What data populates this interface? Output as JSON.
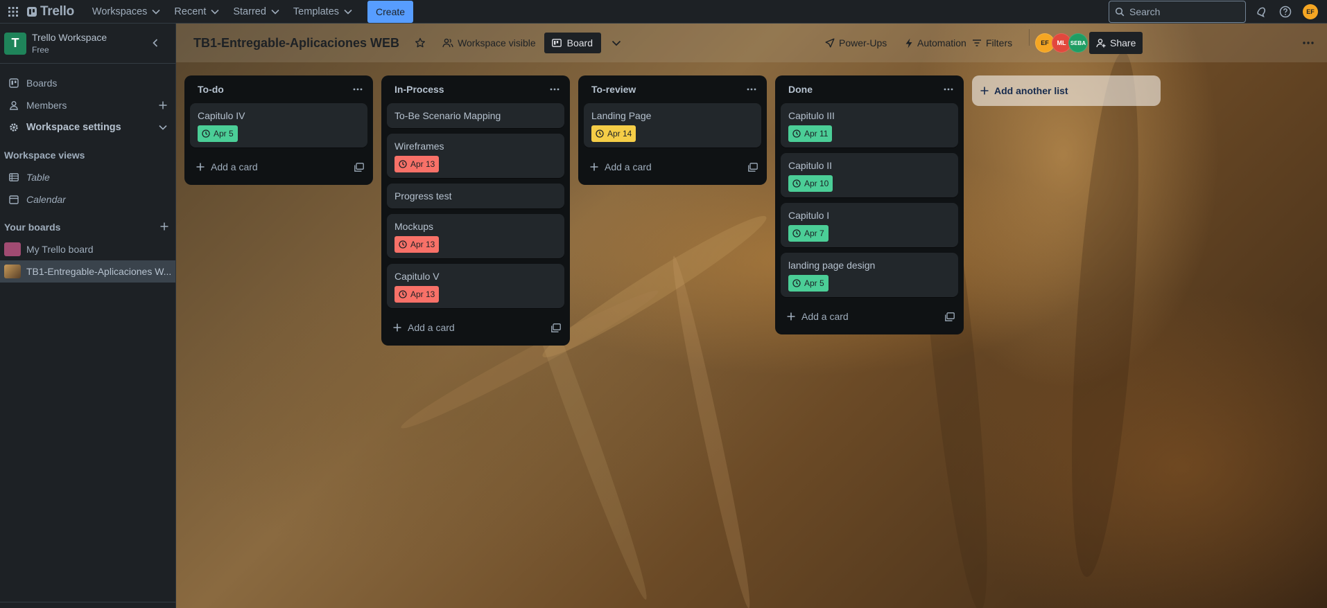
{
  "topnav": {
    "logo": "Trello",
    "menus": [
      "Workspaces",
      "Recent",
      "Starred",
      "Templates"
    ],
    "create_label": "Create",
    "search_placeholder": "Search",
    "user_initials": "EF"
  },
  "sidebar": {
    "workspace_initial": "T",
    "workspace_name": "Trello Workspace",
    "workspace_plan": "Free",
    "items": [
      {
        "label": "Boards",
        "icon": "boards-icon"
      },
      {
        "label": "Members",
        "icon": "members-icon"
      },
      {
        "label": "Workspace settings",
        "icon": "settings-icon"
      }
    ],
    "views_heading": "Workspace views",
    "views": [
      {
        "label": "Table",
        "icon": "table-icon"
      },
      {
        "label": "Calendar",
        "icon": "calendar-icon"
      }
    ],
    "boards_heading": "Your boards",
    "boards": [
      {
        "label": "My Trello board",
        "color": "#a14b72"
      },
      {
        "label": "TB1-Entregable-Aplicaciones W...",
        "color": "#8a6a40"
      }
    ]
  },
  "board": {
    "title": "TB1-Entregable-Aplicaciones WEB",
    "visibility": "Workspace visible",
    "view_label": "Board",
    "powerups": "Power-Ups",
    "automation": "Automation",
    "filters": "Filters",
    "share": "Share",
    "members": [
      {
        "initials": "EF",
        "color": "#f5a623"
      },
      {
        "initials": "ML",
        "color": "#e2483d"
      },
      {
        "initials": "SEBA",
        "color": "#1f9d63"
      }
    ],
    "add_list_label": "Add another list",
    "add_card_label": "Add a card"
  },
  "lists": [
    {
      "name": "To-do",
      "cards": [
        {
          "title": "Capitulo IV",
          "due": "Apr 5",
          "status": "green"
        }
      ]
    },
    {
      "name": "In-Process",
      "cards": [
        {
          "title": "To-Be Scenario Mapping"
        },
        {
          "title": "Wireframes",
          "due": "Apr 13",
          "status": "red"
        },
        {
          "title": "Progress test"
        },
        {
          "title": "Mockups",
          "due": "Apr 13",
          "status": "red"
        },
        {
          "title": "Capitulo V",
          "due": "Apr 13",
          "status": "red"
        }
      ]
    },
    {
      "name": "To-review",
      "cards": [
        {
          "title": "Landing Page",
          "due": "Apr 14",
          "status": "yellow"
        }
      ]
    },
    {
      "name": "Done",
      "cards": [
        {
          "title": "Capitulo III",
          "due": "Apr 11",
          "status": "green"
        },
        {
          "title": "Capitulo II",
          "due": "Apr 10",
          "status": "green"
        },
        {
          "title": "Capitulo I",
          "due": "Apr 7",
          "status": "green"
        },
        {
          "title": "landing page design",
          "due": "Apr 5",
          "status": "green"
        }
      ]
    }
  ]
}
